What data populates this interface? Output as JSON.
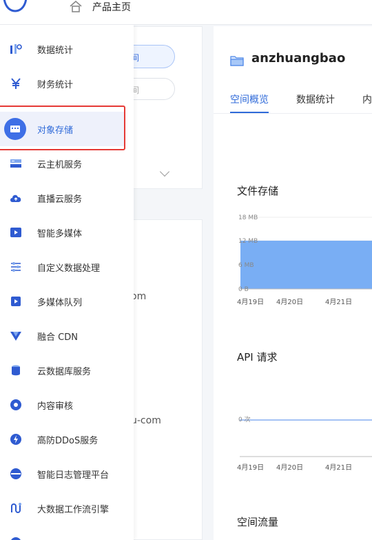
{
  "header": {
    "home_label": "产品主页"
  },
  "sidebar": {
    "items": [
      {
        "label": "数据统计",
        "icon": "bar-chart-icon"
      },
      {
        "label": "财务统计",
        "icon": "yuan-icon"
      },
      {
        "label": "对象存储",
        "icon": "storage-icon",
        "active": true
      },
      {
        "label": "云主机服务",
        "icon": "server-icon"
      },
      {
        "label": "直播云服务",
        "icon": "cloud-upload-icon"
      },
      {
        "label": "智能多媒体",
        "icon": "film-icon"
      },
      {
        "label": "自定义数据处理",
        "icon": "sliders-icon"
      },
      {
        "label": "多媒体队列",
        "icon": "play-queue-icon"
      },
      {
        "label": "融合 CDN",
        "icon": "cdn-icon"
      },
      {
        "label": "云数据库服务",
        "icon": "database-icon"
      },
      {
        "label": "内容审核",
        "icon": "audit-icon"
      },
      {
        "label": "高防DDoS服务",
        "icon": "shield-icon"
      },
      {
        "label": "智能日志管理平台",
        "icon": "log-icon"
      },
      {
        "label": "大数据工作流引擎",
        "icon": "workflow-icon"
      }
    ]
  },
  "background": {
    "pill1_text": "间",
    "pill2_text": "间",
    "fragment1": "om",
    "fragment2": "u-com"
  },
  "bucket": {
    "name": "anzhuangbao",
    "tabs": [
      "空间概览",
      "数据统计",
      "内"
    ]
  },
  "file_storage": {
    "title": "文件存储",
    "y_ticks": [
      "18 MB",
      "12 MB",
      "6 MB",
      "0 B"
    ],
    "x_ticks": [
      "4月19日",
      "4月20日",
      "4月21日"
    ]
  },
  "api_requests": {
    "title": "API 请求",
    "y_tick": "0 次",
    "x_ticks": [
      "4月19日",
      "4月20日",
      "4月21日"
    ]
  },
  "traffic": {
    "title": "空间流量"
  },
  "colors": {
    "accent": "#2f6ad9",
    "area_fill": "#79aef4",
    "highlight": "#e53935"
  }
}
